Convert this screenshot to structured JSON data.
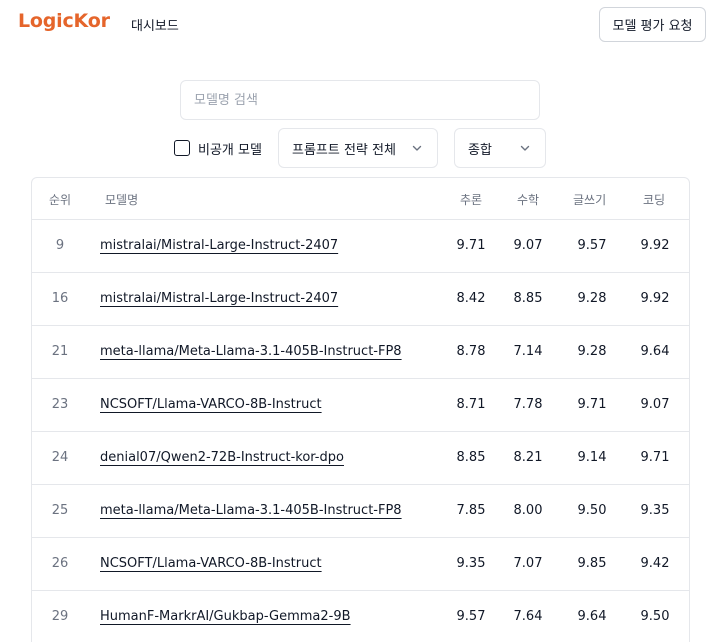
{
  "header": {
    "brand": "LogicKor",
    "nav_dashboard": "대시보드",
    "eval_button": "모델 평가 요청"
  },
  "search": {
    "placeholder": "모델명 검색",
    "value": ""
  },
  "filters": {
    "private_label": "비공개 모델",
    "private_checked": false,
    "prompt_strategy": "프롬프트 전략 전체",
    "category": "종합"
  },
  "table": {
    "headers": {
      "rank": "순위",
      "model": "모델명",
      "reasoning": "추론",
      "math": "수학",
      "writing": "글쓰기",
      "coding": "코딩"
    },
    "rows": [
      {
        "rank": "9",
        "model": "mistralai/Mistral-Large-Instruct-2407",
        "reasoning": "9.71",
        "math": "9.07",
        "writing": "9.57",
        "coding": "9.92"
      },
      {
        "rank": "16",
        "model": "mistralai/Mistral-Large-Instruct-2407",
        "reasoning": "8.42",
        "math": "8.85",
        "writing": "9.28",
        "coding": "9.92"
      },
      {
        "rank": "21",
        "model": "meta-llama/Meta-Llama-3.1-405B-Instruct-FP8",
        "reasoning": "8.78",
        "math": "7.14",
        "writing": "9.28",
        "coding": "9.64"
      },
      {
        "rank": "23",
        "model": "NCSOFT/Llama-VARCO-8B-Instruct",
        "reasoning": "8.71",
        "math": "7.78",
        "writing": "9.71",
        "coding": "9.07"
      },
      {
        "rank": "24",
        "model": "denial07/Qwen2-72B-Instruct-kor-dpo",
        "reasoning": "8.85",
        "math": "8.21",
        "writing": "9.14",
        "coding": "9.71"
      },
      {
        "rank": "25",
        "model": "meta-llama/Meta-Llama-3.1-405B-Instruct-FP8",
        "reasoning": "7.85",
        "math": "8.00",
        "writing": "9.50",
        "coding": "9.35"
      },
      {
        "rank": "26",
        "model": "NCSOFT/Llama-VARCO-8B-Instruct",
        "reasoning": "9.35",
        "math": "7.07",
        "writing": "9.85",
        "coding": "9.42"
      },
      {
        "rank": "29",
        "model": "HumanF-MarkrAI/Gukbap-Gemma2-9B",
        "reasoning": "9.57",
        "math": "7.64",
        "writing": "9.64",
        "coding": "9.50"
      }
    ]
  },
  "colors": {
    "brand": "#e5652b",
    "border": "#e5e7eb",
    "muted": "#6b7280"
  },
  "icons": {
    "dropdown": "chevron-down-icon",
    "checkbox": "checkbox"
  }
}
